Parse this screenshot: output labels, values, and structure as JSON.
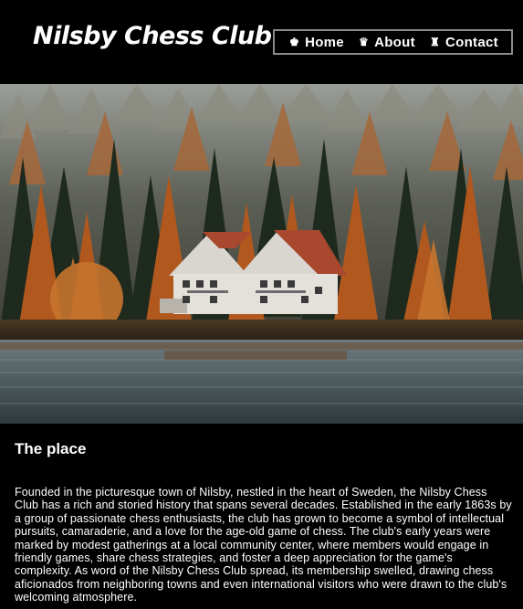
{
  "header": {
    "logo": "Nilsby Chess Club"
  },
  "nav": {
    "items": [
      {
        "label": "Home",
        "icon": "chess-king-icon",
        "glyph": "♚"
      },
      {
        "label": "About",
        "icon": "chess-queen-icon",
        "glyph": "♛"
      },
      {
        "label": "Contact",
        "icon": "chess-rook-icon",
        "glyph": "♜"
      }
    ]
  },
  "hero": {
    "subject": "lakeside house in autumn forest"
  },
  "section": {
    "title": "The place",
    "body": "Founded in the picturesque town of Nilsby, nestled in the heart of Sweden, the Nilsby Chess Club has a rich and storied history that spans several decades. Established in the early 1863s by a group of passionate chess enthusiasts, the club has grown to become a symbol of intellectual pursuits, camaraderie, and a love for the age-old game of chess. The club's early years were marked by modest gatherings at a local community center, where members would engage in friendly games, share chess strategies, and foster a deep appreciation for the game's complexity. As word of the Nilsby Chess Club spread, its membership swelled, drawing chess aficionados from neighboring towns and even international visitors who were drawn to the club's welcoming atmosphere."
  },
  "colors": {
    "background": "#000000",
    "text": "#ffffff",
    "nav_border": "#8a8a8a"
  }
}
